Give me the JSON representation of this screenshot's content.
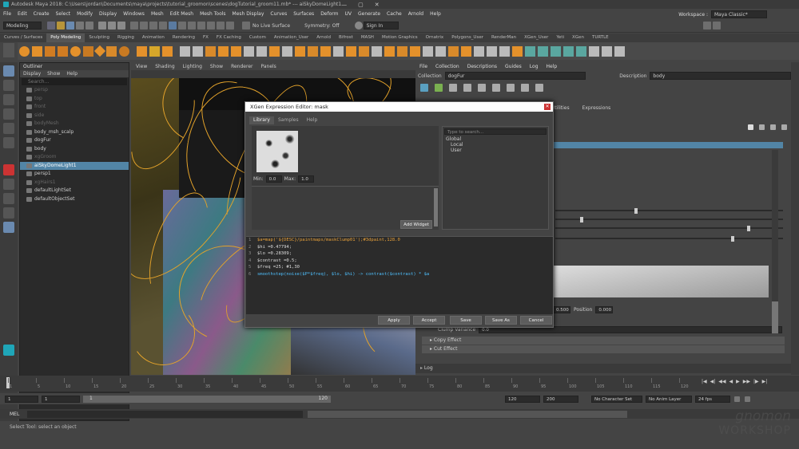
{
  "window": {
    "app_title": "Autodesk Maya 2018: C:\\Users\\jordan\\Documents\\maya\\projects\\tutorial_groomon\\scenes\\dogTutorial_groom11.mb* --- aiSkyDomeLight1"
  },
  "menus": [
    "File",
    "Edit",
    "Create",
    "Select",
    "Modify",
    "Display",
    "Windows",
    "Mesh",
    "Edit Mesh",
    "Mesh Tools",
    "Mesh Display",
    "Curves",
    "Surfaces",
    "Deform",
    "UV",
    "Generate",
    "Cache",
    "Arnold",
    "Help"
  ],
  "workspace": {
    "label": "Workspace :",
    "value": "Maya Classic*"
  },
  "toolbar": {
    "mode": "Modeling",
    "live_surface": "No Live Surface",
    "symmetry": "Symmetry: Off",
    "sign_in": "Sign In"
  },
  "shelf_tabs": [
    "Curves / Surfaces",
    "Poly Modeling",
    "Sculpting",
    "Rigging",
    "Animation",
    "Rendering",
    "FX",
    "FX Caching",
    "Custom",
    "Animation_User",
    "Arnold",
    "Bifrost",
    "MASH",
    "Motion Graphics",
    "Ornatrix",
    "Polygons_User",
    "RenderMan",
    "XGen_User",
    "Yeti",
    "XGen",
    "TURTLE"
  ],
  "active_shelf": "Poly Modeling",
  "outliner": {
    "title": "Outliner",
    "menu": [
      "Display",
      "Show",
      "Help"
    ],
    "search": "Search...",
    "items": [
      {
        "label": "persp",
        "dim": true
      },
      {
        "label": "top",
        "dim": true
      },
      {
        "label": "front",
        "dim": true
      },
      {
        "label": "side",
        "dim": true
      },
      {
        "label": "bodyMesh",
        "dim": true
      },
      {
        "label": "body_msh_scalp",
        "dim": false
      },
      {
        "label": "dogFur",
        "dim": false
      },
      {
        "label": "body",
        "dim": false
      },
      {
        "label": "xgGroom",
        "dim": true
      },
      {
        "label": "aiSkyDomeLight1",
        "dim": false,
        "selected": true
      },
      {
        "label": "persp1",
        "dim": false
      },
      {
        "label": "xgHairs1",
        "dim": true
      },
      {
        "label": "defaultLightSet",
        "dim": false
      },
      {
        "label": "defaultObjectSet",
        "dim": false
      }
    ]
  },
  "viewport": {
    "menu": [
      "View",
      "Shading",
      "Lighting",
      "Show",
      "Renderer",
      "Panels"
    ]
  },
  "xgen": {
    "menu": [
      "File",
      "Collection",
      "Descriptions",
      "Guides",
      "Log",
      "Help"
    ],
    "collection_label": "Collection",
    "collection": "dogFur",
    "description_label": "Description",
    "description": "body",
    "tabs": [
      "Utilities",
      "Expressions"
    ],
    "clump_label": "Clump Variance",
    "clump_value": "0.0",
    "sections": [
      "Copy Effect",
      "Cut Effect"
    ],
    "log": "Log",
    "val1": "0.500",
    "position_label": "Position",
    "position_value": "0.000"
  },
  "dialog": {
    "title": "XGen Expression Editor: mask",
    "tabs": [
      "Library",
      "Samples",
      "Help"
    ],
    "min_label": "Min:",
    "min_value": "0.0",
    "max_label": "Max:",
    "max_value": "1.0",
    "add_widget": "Add Widget",
    "search_placeholder": "Type to search...",
    "tree": [
      "Global",
      "Local",
      "User"
    ],
    "code": [
      {
        "n": "1",
        "t": "$a=map('${DESC}/paintmaps/maskClump01');#3dpaint,128.0"
      },
      {
        "n": "2",
        "t": "$hi =0.47794;"
      },
      {
        "n": "3",
        "t": "$lo =0.28309;"
      },
      {
        "n": "4",
        "t": "$contrast =0.5;"
      },
      {
        "n": "5",
        "t": "$freq =25; #1,30"
      },
      {
        "n": "6",
        "t": "smoothstep(noise($P*$freq), $lo, $hi) -> contrast($contrast) * $a"
      }
    ],
    "buttons": [
      "Apply",
      "Accept",
      "Save",
      "Save As",
      "Cancel"
    ]
  },
  "timeline": {
    "ticks": [
      "1",
      "5",
      "10",
      "15",
      "20",
      "25",
      "30",
      "35",
      "40",
      "45",
      "50",
      "55",
      "60",
      "65",
      "70",
      "75",
      "80",
      "85",
      "90",
      "95",
      "100",
      "105",
      "110",
      "115",
      "120"
    ],
    "current": "1"
  },
  "range": {
    "start": "1",
    "inner_start": "1",
    "slider_value": "1",
    "slider_end": "120",
    "end": "120",
    "outer_end": "200",
    "character_set": "No Character Set",
    "anim_layer": "No Anim Layer",
    "fps": "24 fps"
  },
  "mel": {
    "label": "MEL"
  },
  "status": "Select Tool: select an object",
  "watermark": {
    "line1": "gnomon",
    "line2": "WORKSHOP"
  }
}
